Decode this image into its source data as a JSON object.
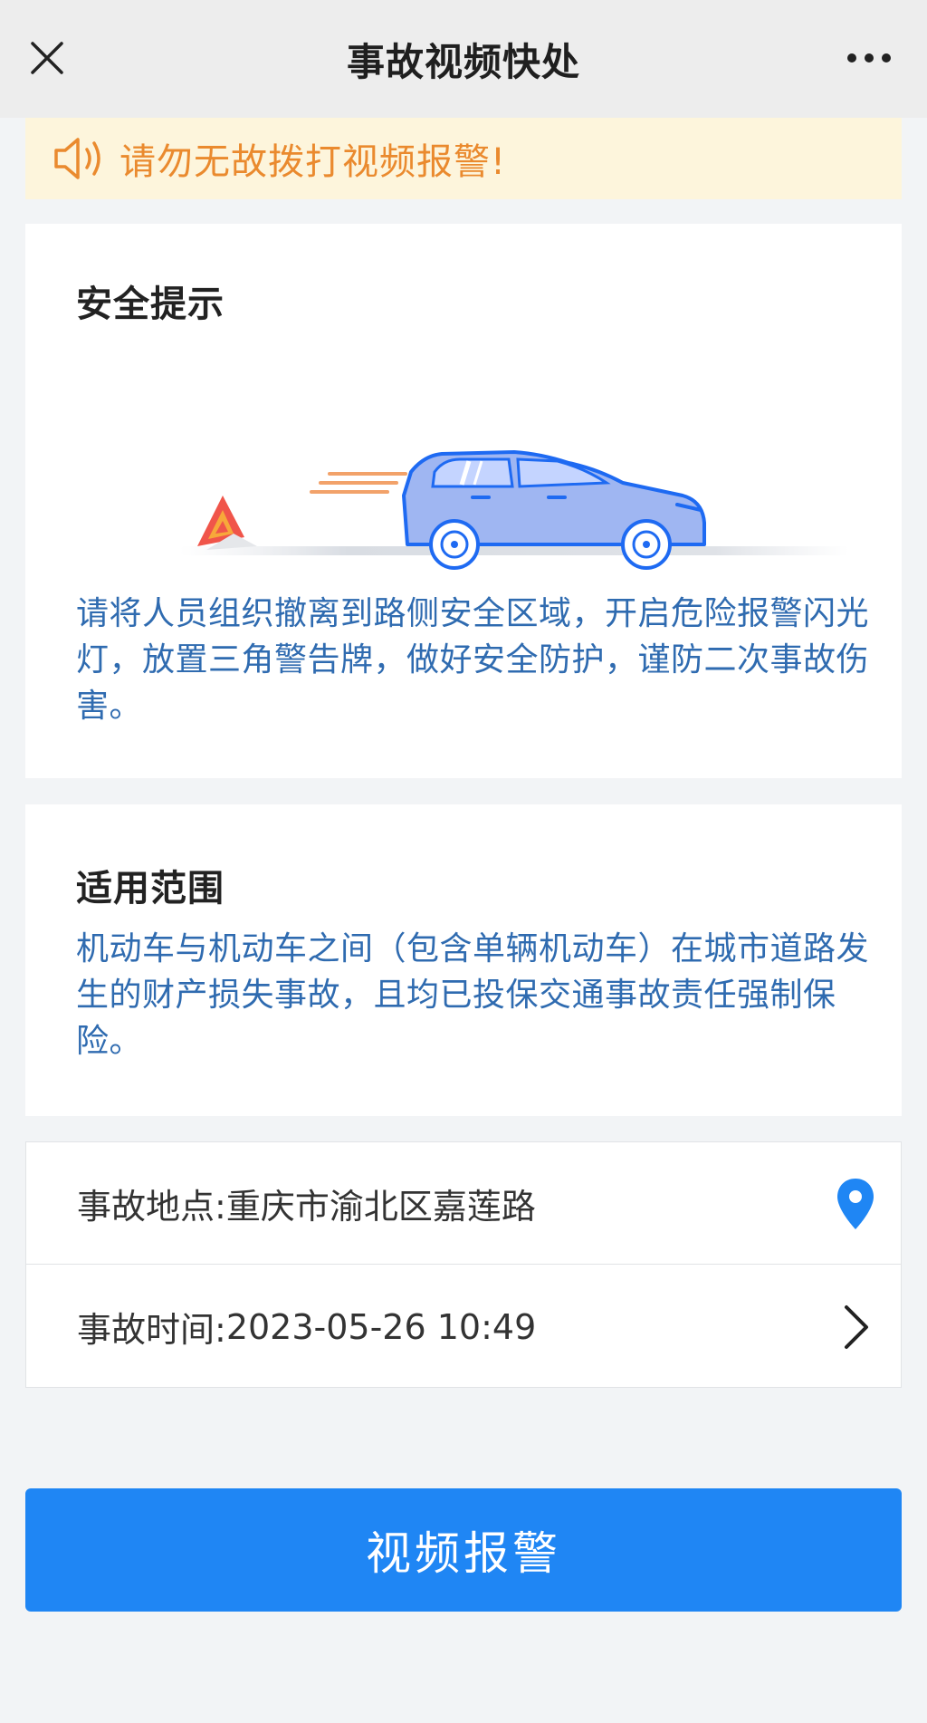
{
  "header": {
    "title": "事故视频快处",
    "close_icon": "close-icon",
    "more_icon": "more-icon"
  },
  "banner": {
    "icon": "speaker-icon",
    "text": "请勿无故拨打视频报警!",
    "color": "#ea8a2e",
    "background": "#fdf5dc"
  },
  "safety": {
    "title": "安全提示",
    "illustration": "car-with-warning-triangle",
    "body": "请将人员组织撤离到路侧安全区域，开启危险报警闪光灯，放置三角警告牌，做好安全防护，谨防二次事故伤害。"
  },
  "scope": {
    "title": "适用范围",
    "body": "机动车与机动车之间（包含单辆机动车）在城市道路发生的财产损失事故，且均已投保交通事故责任强制保险。"
  },
  "form": {
    "location_label": "事故地点:",
    "location_value": "重庆市渝北区嘉莲路",
    "location_icon": "location-pin-icon",
    "time_label": "事故时间:",
    "time_value": "2023-05-26 10:49",
    "time_icon": "chevron-right-icon"
  },
  "primary_button": {
    "label": "视频报警",
    "color": "#1f86f4"
  }
}
